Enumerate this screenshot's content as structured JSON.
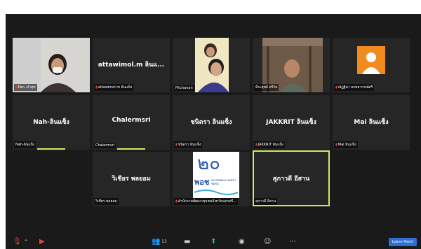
{
  "tiles": {
    "t1": {
      "label": "Pan..ดำสุข"
    },
    "t2": {
      "name": "attawimol.m ลินแ...",
      "label": "attawimol.m ลินแข็ง"
    },
    "t3": {
      "label": "Pitchanan"
    },
    "t4": {
      "label": "มีระยุทธ์ ศรีรัม"
    },
    "t5": {
      "label": "ณัฏฐิมา ยกพยากรณ์ศรี"
    },
    "t6": {
      "name": "Nah-ลินแซ็ง",
      "label": "Nah-ลินแข็ง"
    },
    "t7": {
      "name": "Chalermsri",
      "label": "Chalermsri"
    },
    "t8": {
      "name": "ชนิดรา ลินแซ็ง",
      "label": "ชนิดรา ลินแข็ง"
    },
    "t9": {
      "name": "JAKKRIT ลินแซ็ง",
      "label": "JAKKRIT ลินแข็ง"
    },
    "t10": {
      "name": "Mai ลินแซ็ง",
      "label": "Mai ลินแข็ง"
    },
    "t11": {
      "name": "วิเชียร พลยอม",
      "label": "วิเชียร พลยอม"
    },
    "t12": {
      "label": "สำนักงานพัฒนาชุมชนจังหวัดนครศรี..."
    },
    "t13": {
      "name": "สุภาวดี อีสาน",
      "label": "สุภาวดี อีสาน"
    }
  },
  "logo": {
    "digits": "๒๐",
    "text": "พอช",
    "small": "สถาบันพัฒนาองค์กรชุมชน"
  },
  "toolbar": {
    "participants_count": "13",
    "leave": "Leave Room"
  },
  "colors": {
    "active_speaker": "#d9e36a",
    "muted": "#e0463a",
    "leave": "#2d6fd2",
    "avatar_bg": "#f28b1f"
  }
}
